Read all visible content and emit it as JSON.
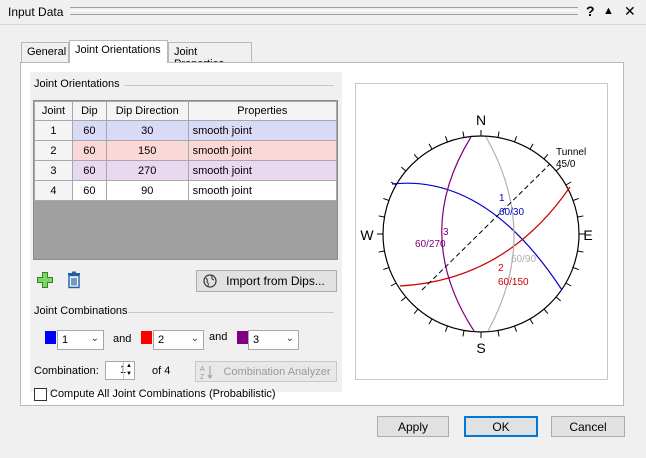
{
  "window": {
    "title": "Input Data",
    "help_label": "?",
    "collapse_label": "▲",
    "close_label": "✕"
  },
  "tabs": [
    {
      "label": "General"
    },
    {
      "label": "Joint Orientations"
    },
    {
      "label": "Joint Properties"
    }
  ],
  "joint_orientations": {
    "group_label": "Joint Orientations",
    "columns": [
      "Joint",
      "Dip",
      "Dip Direction",
      "Properties"
    ],
    "rows": [
      {
        "joint": "1",
        "dip": "60",
        "dip_direction": "30",
        "properties": "smooth joint",
        "color": "#d9d9f8"
      },
      {
        "joint": "2",
        "dip": "60",
        "dip_direction": "150",
        "properties": "smooth joint",
        "color": "#fbd8d8"
      },
      {
        "joint": "3",
        "dip": "60",
        "dip_direction": "270",
        "properties": "smooth joint",
        "color": "#e8d8f0"
      },
      {
        "joint": "4",
        "dip": "60",
        "dip_direction": "90",
        "properties": "smooth joint",
        "color": "#ffffff"
      }
    ],
    "import_button": "Import from Dips..."
  },
  "joint_combinations": {
    "group_label": "Joint Combinations",
    "and_label": "and",
    "selects": [
      {
        "value": "1",
        "color": "#0000ff"
      },
      {
        "value": "2",
        "color": "#ff0000"
      },
      {
        "value": "3",
        "color": "#800080"
      }
    ],
    "combination_label": "Combination:",
    "combination_value": "1",
    "combination_of": "of 4",
    "analyzer_button": "Combination Analyzer",
    "compute_all_label": "Compute All Joint Combinations (Probabilistic)"
  },
  "stereonet": {
    "north": "N",
    "south": "S",
    "east": "E",
    "west": "W",
    "tunnel_label": "Tunnel",
    "tunnel_orientation": "45/0",
    "plane_labels": [
      {
        "id": "1",
        "orientation": "60/30",
        "color": "#0000cc"
      },
      {
        "id": "2",
        "orientation": "60/150",
        "color": "#cc0000"
      },
      {
        "id": "3",
        "orientation": "60/270",
        "color": "#800080"
      },
      {
        "id": "",
        "orientation": "60/90",
        "color": "#b0b0b0"
      }
    ]
  },
  "footer": {
    "apply": "Apply",
    "ok": "OK",
    "cancel": "Cancel"
  }
}
